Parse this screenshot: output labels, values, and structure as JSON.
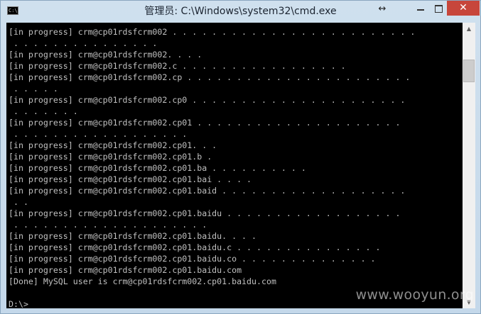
{
  "window": {
    "title": "管理员: C:\\Windows\\system32\\cmd.exe",
    "app_icon_text": "C:\\",
    "resize_icon": "↔",
    "close_glyph": "✕"
  },
  "console": {
    "lines": [
      "[in progress] crm@cp01rdsfcrm002 . . . . . . . . . . . . . . . . . . . . . . . . .",
      " . . . . . . . . . . . . . . .",
      "[in progress] crm@cp01rdsfcrm002. . . .",
      "[in progress] crm@cp01rdsfcrm002.c . . . . . . . . . . . . . . . . .",
      "[in progress] crm@cp01rdsfcrm002.cp . . . . . . . . . . . . . . . . . . . . . . .",
      " . . . . .",
      "[in progress] crm@cp01rdsfcrm002.cp0 . . . . . . . . . . . . . . . . . . . . . .",
      " . . . . . . .",
      "[in progress] crm@cp01rdsfcrm002.cp01 . . . . . . . . . . . . . . . . . . . . .",
      " . . . . . . . . . . . . . . . . . .",
      "[in progress] crm@cp01rdsfcrm002.cp01. . .",
      "[in progress] crm@cp01rdsfcrm002.cp01.b .",
      "[in progress] crm@cp01rdsfcrm002.cp01.ba . . . . . . . . . .",
      "[in progress] crm@cp01rdsfcrm002.cp01.bai . . . .",
      "[in progress] crm@cp01rdsfcrm002.cp01.baid . . . . . . . . . . . . . . . . . . .",
      " . .",
      "[in progress] crm@cp01rdsfcrm002.cp01.baidu . . . . . . . . . . . . . . . . . .",
      " . . . . . . . . . . . . . . . . . . . .",
      "[in progress] crm@cp01rdsfcrm002.cp01.baidu. . . .",
      "[in progress] crm@cp01rdsfcrm002.cp01.baidu.c . . . . . . . . . . . . . . .",
      "[in progress] crm@cp01rdsfcrm002.cp01.baidu.co . . . . . . . . . . . . . .",
      "[in progress] crm@cp01rdsfcrm002.cp01.baidu.com",
      "[Done] MySQL user is crm@cp01rdsfcrm002.cp01.baidu.com",
      "",
      "D:\\>"
    ]
  },
  "scrollbar": {
    "up_glyph": "▲",
    "down_glyph": "▼"
  },
  "watermark": "www.wooyun.org"
}
